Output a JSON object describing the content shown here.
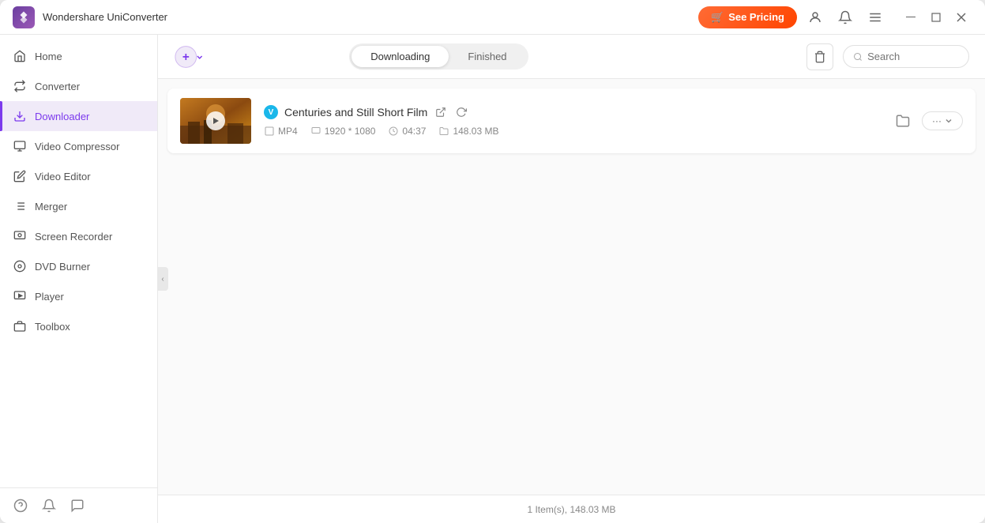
{
  "app": {
    "title": "Wondershare UniConverter",
    "logo_color": "#6b3fa0"
  },
  "titlebar": {
    "see_pricing": "See Pricing",
    "cart_icon": "🛒"
  },
  "sidebar": {
    "items": [
      {
        "id": "home",
        "label": "Home",
        "icon": "home"
      },
      {
        "id": "converter",
        "label": "Converter",
        "icon": "converter"
      },
      {
        "id": "downloader",
        "label": "Downloader",
        "icon": "downloader",
        "active": true
      },
      {
        "id": "video-compressor",
        "label": "Video Compressor",
        "icon": "compress"
      },
      {
        "id": "video-editor",
        "label": "Video Editor",
        "icon": "edit"
      },
      {
        "id": "merger",
        "label": "Merger",
        "icon": "merge"
      },
      {
        "id": "screen-recorder",
        "label": "Screen Recorder",
        "icon": "record"
      },
      {
        "id": "dvd-burner",
        "label": "DVD Burner",
        "icon": "dvd"
      },
      {
        "id": "player",
        "label": "Player",
        "icon": "player"
      },
      {
        "id": "toolbox",
        "label": "Toolbox",
        "icon": "toolbox"
      }
    ],
    "bottom_icons": [
      "help",
      "bell",
      "feedback"
    ]
  },
  "tabs": {
    "downloading": "Downloading",
    "finished": "Finished",
    "active": "downloading"
  },
  "search": {
    "placeholder": "Search"
  },
  "content": {
    "video": {
      "title": "Centuries and Still Short Film",
      "platform": "V",
      "platform_color": "#1ab7ea",
      "format": "MP4",
      "resolution": "1920 * 1080",
      "duration": "04:37",
      "size": "148.03 MB"
    }
  },
  "statusbar": {
    "text": "1 Item(s), 148.03 MB"
  }
}
